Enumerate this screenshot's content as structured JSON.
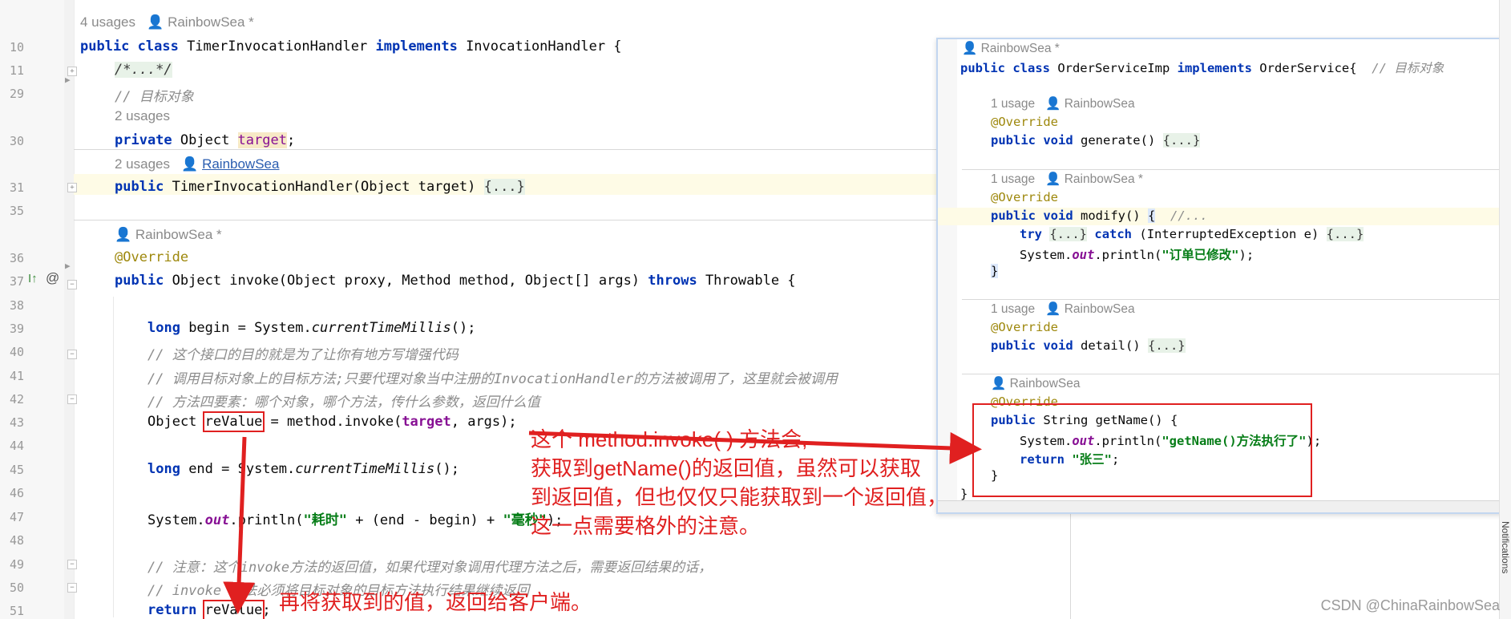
{
  "editor": {
    "line_numbers": [
      "10",
      "11",
      "29",
      "30",
      "31",
      "35",
      "36",
      "37",
      "38",
      "39",
      "40",
      "41",
      "42",
      "43",
      "44",
      "45",
      "46",
      "47",
      "48",
      "49",
      "50",
      "51"
    ],
    "meta_4_usages": "4 usages",
    "meta_author_modified": "RainbowSea *",
    "meta_2_usages": "2 usages",
    "meta_author_link": "RainbowSea",
    "l10_kw1": "public class",
    "l10_name": " TimerInvocationHandler ",
    "l10_kw2": "implements",
    "l10_rest": " InvocationHandler {",
    "l11_fold": "/*...*/",
    "l29_comment": "// 目标对象",
    "l30_kw": "private",
    "l30_type": " Object ",
    "l30_field": "target",
    "l30_end": ";",
    "l31_kw": "public",
    "l31_rest": " TimerInvocationHandler(Object target) ",
    "l31_fold": "{...}",
    "l36_ann": "@Override",
    "l37_kw": "public",
    "l37_mid": " Object invoke(Object proxy, Method method, Object[] args) ",
    "l37_kw2": "throws",
    "l37_end": " Throwable {",
    "l39_kw": "long",
    "l39_a": " begin = System.",
    "l39_it": "currentTimeMillis",
    "l39_b": "();",
    "l40_comment": "// 这个接口的目的就是为了让你有地方写增强代码",
    "l41_comment": "// 调用目标对象上的目标方法;只要代理对象当中注册的InvocationHandler的方法被调用了，这里就会被调用",
    "l42_comment": "// 方法四要素：哪个对象，哪个方法，传什么参数，返回什么值",
    "l43_a": "Object ",
    "l43_var": "reValue",
    "l43_b": " = method.invoke(",
    "l43_field": "target",
    "l43_c": ", args);",
    "l45_kw": "long",
    "l45_a": " end = System.",
    "l45_it": "currentTimeMillis",
    "l45_b": "();",
    "l47_a": "System.",
    "l47_out": "out",
    "l47_b": ".println(",
    "l47_s1": "\"耗时\"",
    "l47_c": " + (end - begin) + ",
    "l47_s2": "\"毫秒\"",
    "l47_d": ");",
    "l49_comment": "// 注意：这个invoke方法的返回值，如果代理对象调用代理方法之后，需要返回结果的话，",
    "l50_comment": "// invoke 方法必须将目标对象的目标方法执行结果继续返回",
    "l51_kw": "return",
    "l51_var": "reValue",
    "l51_end": ";"
  },
  "popup": {
    "author_mod": "RainbowSea *",
    "author": "RainbowSea",
    "usage_1": "1 usage",
    "h_kw1": "public class",
    "h_name": " OrderServiceImp ",
    "h_kw2": "implements",
    "h_rest": " OrderService{  ",
    "h_comment": "// 目标对象",
    "override": "@Override",
    "kw_public_void": "public void",
    "generate": " generate() ",
    "fold": "{...}",
    "modify": " modify() ",
    "modify_brace": "{",
    "modify_comment": "  //...",
    "try_kw": "try",
    "catch_kw": "catch",
    "catch_rest": " (InterruptedException e) ",
    "println_a": "System.",
    "println_out": "out",
    "println_b": ".println(",
    "println_str": "\"订单已修改\"",
    "println_c": ");",
    "close_brace": "}",
    "detail": " detail() ",
    "getname_kw": "public",
    "getname_rest": " String getName() {",
    "getname_str": "\"getName()方法执行了\"",
    "return_kw": "return",
    "return_str": "\"张三\"",
    "return_end": ";",
    "class_close": "}"
  },
  "annotations": {
    "callout_line1": "这个 method.invoke( ) 方法会,",
    "callout_line2": "获取到getName()的返回值，虽然可以获取",
    "callout_line3": "到返回值，但也仅仅只能获取到一个返回值，",
    "callout_line4": "这一点需要格外的注意。",
    "bottom_note": "再将获取到的值，返回给客户端。",
    "arrow_color": "#e02020"
  },
  "sidebar": {
    "notifications_label": "Notifications"
  },
  "watermark": "CSDN @ChinaRainbowSea"
}
